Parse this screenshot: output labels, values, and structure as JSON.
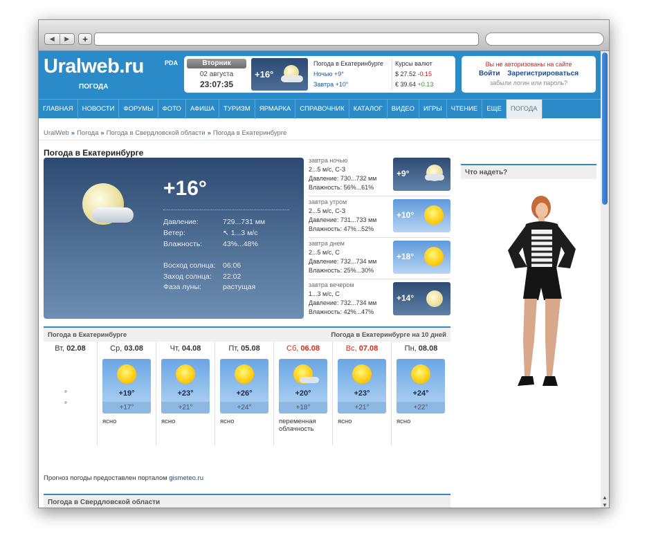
{
  "browser": {
    "back": "◀",
    "forward": "▶",
    "add": "+"
  },
  "header": {
    "logo": "Uralweb.ru",
    "logo_sub": "ПОГОДА",
    "pda": "PDA",
    "day_name": "Вторник",
    "date": "02 августа",
    "time": "23:07:35",
    "mini_temp": "+16°",
    "forecast_title": "Погода в Екатеринбурге",
    "night": "Ночью +9°",
    "tomorrow": "Завтра +10°",
    "rates_title": "Курсы валют",
    "usd_label": "$ 27.52",
    "usd_change": "-0.15",
    "eur_label": "€ 39.64",
    "eur_change": "+0.13",
    "auth_warning": "Вы не авторизованы на сайте",
    "login": "Войти",
    "register": "Зарегистрироваться",
    "forgot": "забыли логин или пароль?"
  },
  "menu": [
    "ГЛАВНАЯ",
    "НОВОСТИ",
    "ФОРУМЫ",
    "ФОТО",
    "АФИША",
    "ТУРИЗМ",
    "ЯРМАРКА",
    "СПРАВОЧНИК",
    "КАТАЛОГ",
    "ВИДЕО",
    "ИГРЫ",
    "ЧТЕНИЕ",
    "ЕЩЕ",
    "ПОГОДА"
  ],
  "breadcrumb": [
    "UralWeb",
    "Погода",
    "Погода в Свердловской области",
    "Погода в Екатеринбурге"
  ],
  "breadcrumb_sep": "»",
  "page_title": "Погода в Екатеринбурге",
  "current": {
    "temp": "+16°",
    "pressure_label": "Давление:",
    "pressure": "729...731 мм",
    "wind_label": "Ветер:",
    "wind": "1...3 м/с",
    "humidity_label": "Влажность:",
    "humidity": "43%...48%",
    "sunrise_label": "Восход солнца:",
    "sunrise": "06:06",
    "sunset_label": "Заход солнца:",
    "sunset": "22:02",
    "moon_label": "Фаза луны:",
    "moon": "растущая"
  },
  "periods": [
    {
      "title": "завтра ночью",
      "wind": "2...5 м/с, С-З",
      "pressure": "Давление: 730...732 мм",
      "humidity": "Влажность: 56%...61%",
      "temp": "+9°",
      "kind": "night"
    },
    {
      "title": "завтра утром",
      "wind": "2...5 м/с, С-З",
      "pressure": "Давление: 731...733 мм",
      "humidity": "Влажность: 47%...52%",
      "temp": "+10°",
      "kind": "day"
    },
    {
      "title": "завтра днем",
      "wind": "2...5 м/с, С",
      "pressure": "Давление: 732...734 мм",
      "humidity": "Влажность: 25%...30%",
      "temp": "+18°",
      "kind": "day"
    },
    {
      "title": "завтра вечером",
      "wind": "1...3 м/с, С",
      "pressure": "Давление: 732...734 мм",
      "humidity": "Влажность: 42%...47%",
      "temp": "+14°",
      "kind": "night"
    }
  ],
  "tenday": {
    "left_title": "Погода в Екатеринбурге",
    "right_title": "Погода в Екатеринбурге на 10 дней",
    "today": {
      "day": "Вт,",
      "date": "02.08",
      "deg1": "°",
      "deg2": "°"
    },
    "days": [
      {
        "day": "Ср,",
        "date": "03.08",
        "max": "+19°",
        "min": "+17°",
        "desc": "ясно",
        "weekend": false
      },
      {
        "day": "Чт,",
        "date": "04.08",
        "max": "+23°",
        "min": "+21°",
        "desc": "ясно",
        "weekend": false
      },
      {
        "day": "Пт,",
        "date": "05.08",
        "max": "+26°",
        "min": "+24°",
        "desc": "ясно",
        "weekend": false
      },
      {
        "day": "Сб,",
        "date": "06.08",
        "max": "+20°",
        "min": "+18°",
        "desc": "переменная облачность",
        "weekend": true
      },
      {
        "day": "Вс,",
        "date": "07.08",
        "max": "+23°",
        "min": "+21°",
        "desc": "ясно",
        "weekend": true
      },
      {
        "day": "Пн,",
        "date": "08.08",
        "max": "+24°",
        "min": "+22°",
        "desc": "ясно",
        "weekend": false
      }
    ]
  },
  "credit_text": "Прогноз погоды предоставлен порталом",
  "credit_link": "gismeteo.ru",
  "region_title": "Погода в Свердловской области",
  "sidebar_title": "Что надеть?",
  "colors": {
    "brand": "#2a8bc8",
    "warning": "#d22222",
    "link": "#1a4a8a"
  }
}
